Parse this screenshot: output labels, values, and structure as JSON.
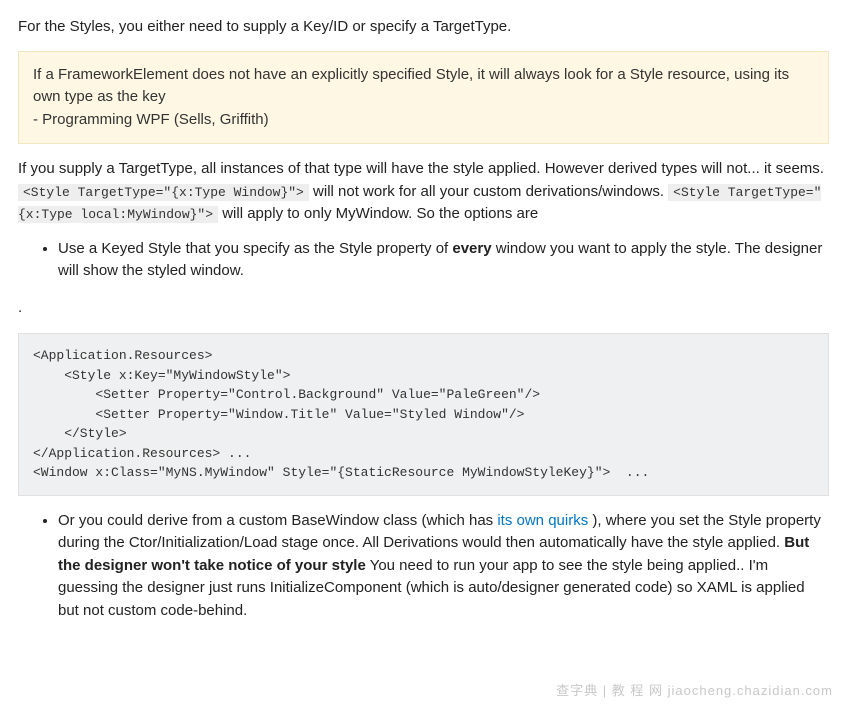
{
  "intro": "For the Styles, you either need to supply a Key/ID or specify a TargetType.",
  "quote": {
    "line1": "If a FrameworkElement does not have an explicitly specified Style, it will always look for a Style resource, using its own type as the key",
    "line2": "- Programming WPF (Sells, Griffith)"
  },
  "para2": {
    "segA": "If you supply a TargetType, all instances of that type will have the style applied. However derived types will not... it seems. ",
    "code1": "<Style TargetType=\"{x:Type Window}\">",
    "segB": " will not work for all your custom derivations/windows. ",
    "code2": "<Style TargetType=\"{x:Type local:MyWindow}\">",
    "segC": " will apply to only MyWindow. So the options are"
  },
  "bullet1": {
    "segA": "Use a Keyed Style that you specify as the Style property of ",
    "strong": "every",
    "segB": " window you want to apply the style. The designer will show the styled window."
  },
  "dotline": ".",
  "codeblock": "<Application.Resources>\n    <Style x:Key=\"MyWindowStyle\">\n        <Setter Property=\"Control.Background\" Value=\"PaleGreen\"/>\n        <Setter Property=\"Window.Title\" Value=\"Styled Window\"/>\n    </Style>\n</Application.Resources> ...\n<Window x:Class=\"MyNS.MyWindow\" Style=\"{StaticResource MyWindowStyleKey}\">  ...",
  "bullet2": {
    "segA": "Or you could derive from a custom BaseWindow class (which has ",
    "link": "its own quirks",
    "segB": "), where you set the Style property during the Ctor/Initialization/Load stage once. All Derivations would then automatically have the style applied. ",
    "strong": "But the designer won't take notice of your style",
    "segC": " You need to run your app to see the style being applied.. I'm guessing the designer just runs InitializeComponent (which is auto/designer generated code) so XAML is applied but not custom code-behind."
  },
  "watermark": "查字典 | 教 程 网\njiaocheng.chazidian.com"
}
